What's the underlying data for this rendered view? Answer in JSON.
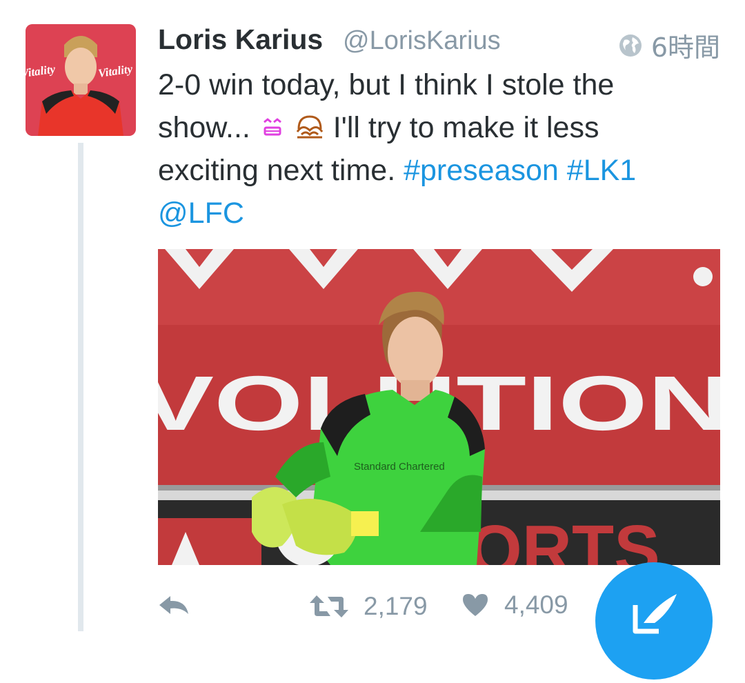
{
  "tweet": {
    "author_name": "Loris Karius",
    "author_handle": "@LorisKarius",
    "timestamp": "6時間",
    "text_line1": "2-0 win today, but I think I stole the",
    "text_line2_part1": "show... ",
    "text_line2_part2": " I'll try to make it less",
    "text_line3_part1": "exciting next time. ",
    "hashtag1": "#preseason",
    "hashtag2": "#LK1",
    "mention": "@LFC"
  },
  "photo": {
    "banner_text": "VOLUTION",
    "bottom_text": "ORTS",
    "shirt_text": "Standard Chartered"
  },
  "actions": {
    "retweet_count": "2,179",
    "like_count": "4,409"
  },
  "icons": {
    "reply": "reply-icon",
    "retweet": "retweet-icon",
    "like": "heart-icon",
    "globe": "globe-icon",
    "compose": "compose-icon"
  },
  "colors": {
    "link": "#1b95e0",
    "fab": "#1da1f2",
    "muted": "#8899a6",
    "text": "#292f33"
  },
  "avatar": {
    "sponsor_text": "Vitality"
  }
}
